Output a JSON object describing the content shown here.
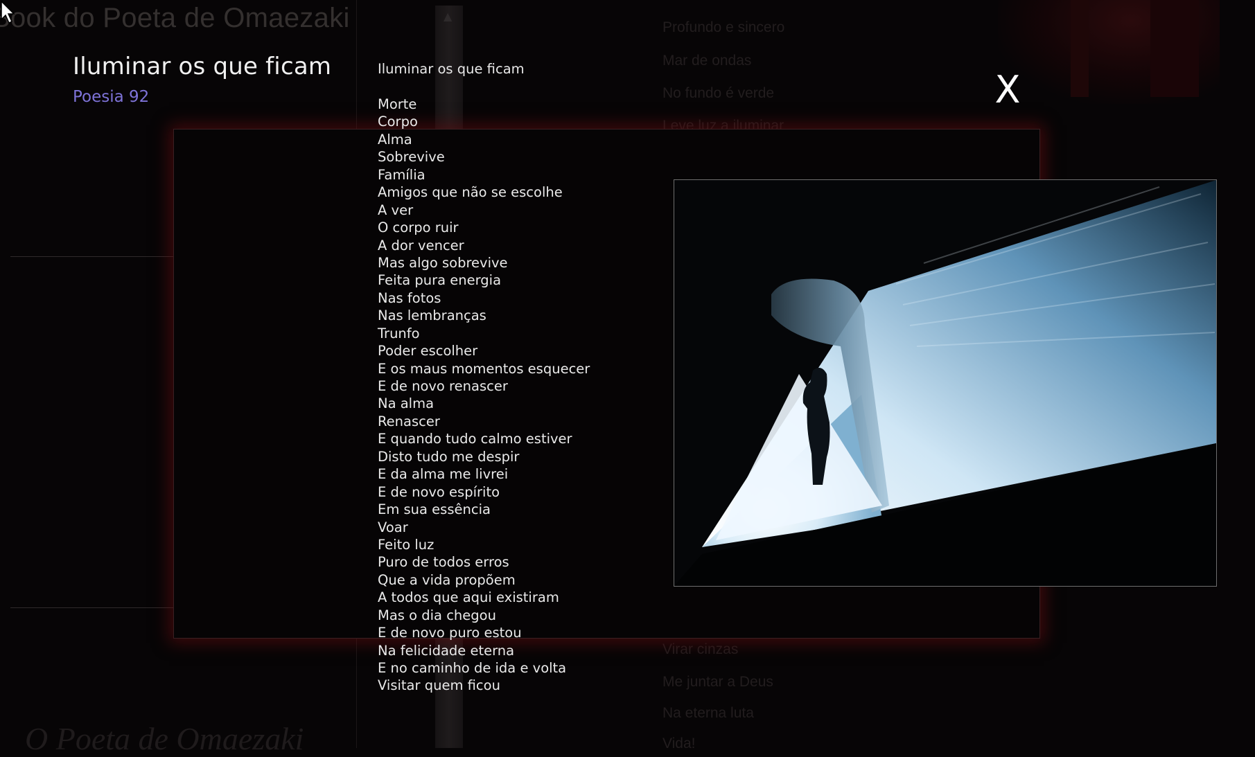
{
  "background": {
    "site_title": "Book do Poeta de Omaezaki",
    "footer_title": "O Poeta de Omaezaki",
    "list_items": [
      "Profundo e sincero",
      "Mar de ondas",
      "No fundo é verde",
      "Leve luz a iluminar",
      "Virar cinzas",
      "Me juntar a Deus",
      "Na eterna luta",
      "Vida!"
    ]
  },
  "header": {
    "title": "Iluminar os que ficam",
    "subtitle": "Poesia 92"
  },
  "close_button": {
    "label": "X"
  },
  "poem": {
    "title": "Iluminar os que ficam",
    "lines": [
      "Morte",
      "Corpo",
      "Alma",
      "Sobrevive",
      "Família",
      "Amigos que não se escolhe",
      "A ver",
      "O corpo ruir",
      "A dor vencer",
      "Mas algo sobrevive",
      "Feita pura energia",
      "Nas fotos",
      "Nas lembranças",
      "Trunfo",
      "Poder escolher",
      "E os maus momentos esquecer",
      "E de novo renascer",
      "Na alma",
      "Renascer",
      "E quando tudo calmo estiver",
      "Disto tudo me despir",
      "E da alma me livrei",
      "E de novo espírito",
      "Em sua essência",
      "Voar",
      "Feito luz",
      "Puro de todos erros",
      "Que a vida propõem",
      "A todos que aqui existiram",
      "Mas o dia chegou",
      "E de novo puro estou",
      "Na felicidade eterna",
      "E no caminho de ida e volta",
      "Visitar quem ficou"
    ]
  },
  "colors": {
    "subtitle_accent": "#7e73d8",
    "frame_glow": "#6e0c10",
    "background": "#070506"
  }
}
